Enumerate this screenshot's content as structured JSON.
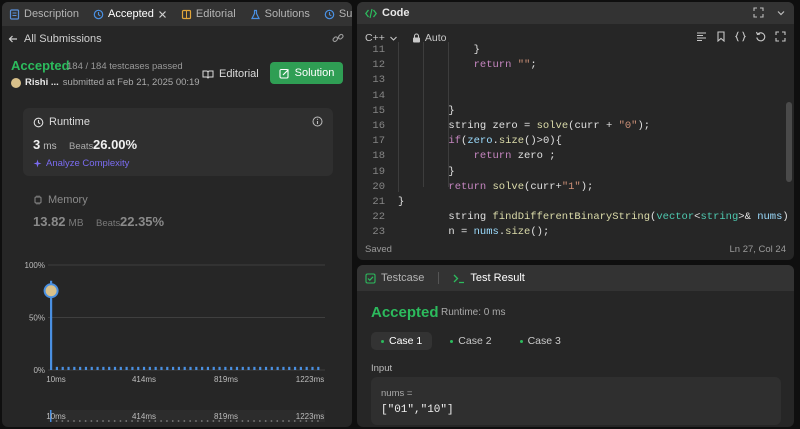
{
  "left_tabs": [
    {
      "label": "Description",
      "active": false
    },
    {
      "label": "Accepted",
      "active": true
    },
    {
      "label": "Editorial",
      "active": false
    },
    {
      "label": "Solutions",
      "active": false
    },
    {
      "label": "Submissi",
      "active": false
    }
  ],
  "submissions": {
    "back_label": "All Submissions",
    "status": "Accepted",
    "pass_count": "184 / 184 testcases passed",
    "username": "Rishi ...",
    "submitted_at": "submitted at Feb 21, 2025 00:19",
    "editorial_button": "Editorial",
    "solution_button": "Solution"
  },
  "runtime": {
    "label": "Runtime",
    "value": "3",
    "unit": "ms",
    "beats_label": "Beats",
    "beats_value": "26.00%",
    "analyze_label": "Analyze Complexity"
  },
  "memory": {
    "label": "Memory",
    "value": "13.82",
    "unit": "MB",
    "beats_label": "Beats",
    "beats_value": "22.35%"
  },
  "chart_data": {
    "type": "bar",
    "y_ticks": [
      "100%",
      "50%",
      "0%"
    ],
    "ylim": [
      0,
      100
    ],
    "x_ticks": [
      "10ms",
      "414ms",
      "819ms",
      "1223ms"
    ],
    "peak_value": 85,
    "bar_count": 47,
    "bar_values": [
      85,
      3,
      3,
      3,
      3,
      3,
      3,
      3,
      3,
      3,
      3,
      3,
      3,
      3,
      3,
      3,
      3,
      3,
      3,
      3,
      3,
      3,
      3,
      3,
      3,
      3,
      3,
      3,
      3,
      3,
      3,
      3,
      3,
      3,
      3,
      3,
      3,
      3,
      3,
      3,
      3,
      3,
      3,
      3,
      3,
      3,
      3
    ],
    "brush_ticks": [
      "10ms",
      "414ms",
      "819ms",
      "1223ms"
    ],
    "bar_color": "#4a90e2"
  },
  "code": {
    "tab_label": "Code",
    "language": "C++",
    "mode": "Auto",
    "status": "Saved",
    "cursor": "Ln 27, Col 24",
    "lines": [
      {
        "n": "11",
        "indent": 3,
        "tokens": [
          {
            "t": "}",
            "c": ""
          }
        ]
      },
      {
        "n": "12",
        "indent": 3,
        "tokens": [
          {
            "t": "return ",
            "c": "kw"
          },
          {
            "t": "\"\"",
            "c": "st"
          },
          {
            "t": ";",
            "c": ""
          }
        ]
      },
      {
        "n": "13",
        "indent": 0,
        "tokens": []
      },
      {
        "n": "14",
        "indent": 0,
        "tokens": []
      },
      {
        "n": "15",
        "indent": 2,
        "tokens": [
          {
            "t": "}",
            "c": ""
          }
        ]
      },
      {
        "n": "16",
        "indent": 2,
        "tokens": [
          {
            "t": "string ",
            "c": ""
          },
          {
            "t": "zero",
            "c": ""
          },
          {
            "t": " = ",
            "c": ""
          },
          {
            "t": "solve",
            "c": "fn"
          },
          {
            "t": "(curr + ",
            "c": ""
          },
          {
            "t": "\"0\"",
            "c": "st"
          },
          {
            "t": ");",
            "c": ""
          }
        ]
      },
      {
        "n": "17",
        "indent": 2,
        "tokens": [
          {
            "t": "if",
            "c": "kw"
          },
          {
            "t": "(",
            "c": ""
          },
          {
            "t": "zero",
            "c": "vr"
          },
          {
            "t": ".",
            "c": ""
          },
          {
            "t": "size",
            "c": "fn"
          },
          {
            "t": "()>0){",
            "c": ""
          }
        ]
      },
      {
        "n": "18",
        "indent": 3,
        "tokens": [
          {
            "t": "return ",
            "c": "kw"
          },
          {
            "t": "zero ;",
            "c": ""
          }
        ]
      },
      {
        "n": "19",
        "indent": 2,
        "tokens": [
          {
            "t": "}",
            "c": ""
          }
        ]
      },
      {
        "n": "20",
        "indent": 2,
        "tokens": [
          {
            "t": "return ",
            "c": "kw"
          },
          {
            "t": "solve",
            "c": "fn"
          },
          {
            "t": "(curr+",
            "c": ""
          },
          {
            "t": "\"1\"",
            "c": "st"
          },
          {
            "t": ");",
            "c": ""
          }
        ]
      },
      {
        "n": "21",
        "indent": 0,
        "tokens": [
          {
            "t": "}",
            "c": ""
          }
        ]
      },
      {
        "n": "22",
        "indent": 2,
        "tokens": [
          {
            "t": "string ",
            "c": ""
          },
          {
            "t": "findDifferentBinaryString",
            "c": "fn"
          },
          {
            "t": "(",
            "c": ""
          },
          {
            "t": "vector",
            "c": "ty"
          },
          {
            "t": "<",
            "c": ""
          },
          {
            "t": "string",
            "c": "ty"
          },
          {
            "t": ">& ",
            "c": ""
          },
          {
            "t": "nums",
            "c": "vr"
          },
          {
            "t": ") {",
            "c": ""
          }
        ]
      },
      {
        "n": "23",
        "indent": 2,
        "tokens": [
          {
            "t": "n",
            "c": ""
          },
          {
            "t": " = ",
            "c": ""
          },
          {
            "t": "nums",
            "c": "vr"
          },
          {
            "t": ".",
            "c": ""
          },
          {
            "t": "size",
            "c": "fn"
          },
          {
            "t": "();",
            "c": ""
          }
        ]
      }
    ]
  },
  "result": {
    "testcase_tab": "Testcase",
    "result_tab": "Test Result",
    "status": "Accepted",
    "runtime": "Runtime: 0 ms",
    "cases": [
      "Case 1",
      "Case 2",
      "Case 3"
    ],
    "input_label": "Input",
    "input_name": "nums =",
    "input_value": "[\"01\",\"10\"]"
  },
  "colors": {
    "accepted": "#2cbb5d",
    "solution_button": "#2f9e54",
    "analyze": "#7b6cf2",
    "bar": "#4a90e2"
  }
}
